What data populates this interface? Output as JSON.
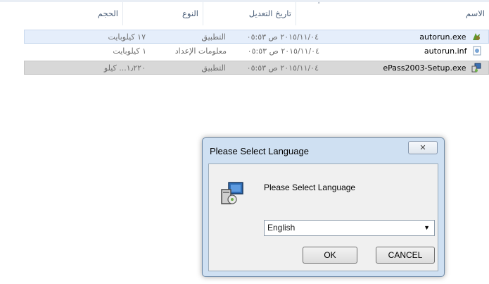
{
  "columns": {
    "name": "الاسم",
    "date": "تاريخ التعديل",
    "type": "النوع",
    "size": "الحجم"
  },
  "files": [
    {
      "name": "autorun.exe",
      "date": "٢٠١٥/١١/٠٤ ص ٠٥:٥٣",
      "type": "التطبيق",
      "size": "١٧ كيلوبايت",
      "icon": "setup-app-icon"
    },
    {
      "name": "autorun.inf",
      "date": "٢٠١٥/١١/٠٤ ص ٠٥:٥٣",
      "type": "معلومات الإعداد",
      "size": "١ كيلوبايت",
      "icon": "settings-file-icon"
    },
    {
      "name": "ePass2003-Setup.exe",
      "date": "٢٠١٥/١١/٠٤ ص ٠٥:٥٣",
      "type": "التطبيق",
      "size": "١٫٢٢٠... كيلو",
      "icon": "installer-icon"
    }
  ],
  "dialog": {
    "title": "Please Select Language",
    "close_glyph": "✕",
    "prompt": "Please Select Language",
    "language_selected": "English",
    "ok_label": "OK",
    "cancel_label": "CANCEL",
    "icon": "installer-icon"
  },
  "colors": {
    "selection": "#e5eefb",
    "dialog_frame": "#cfe0f2"
  }
}
